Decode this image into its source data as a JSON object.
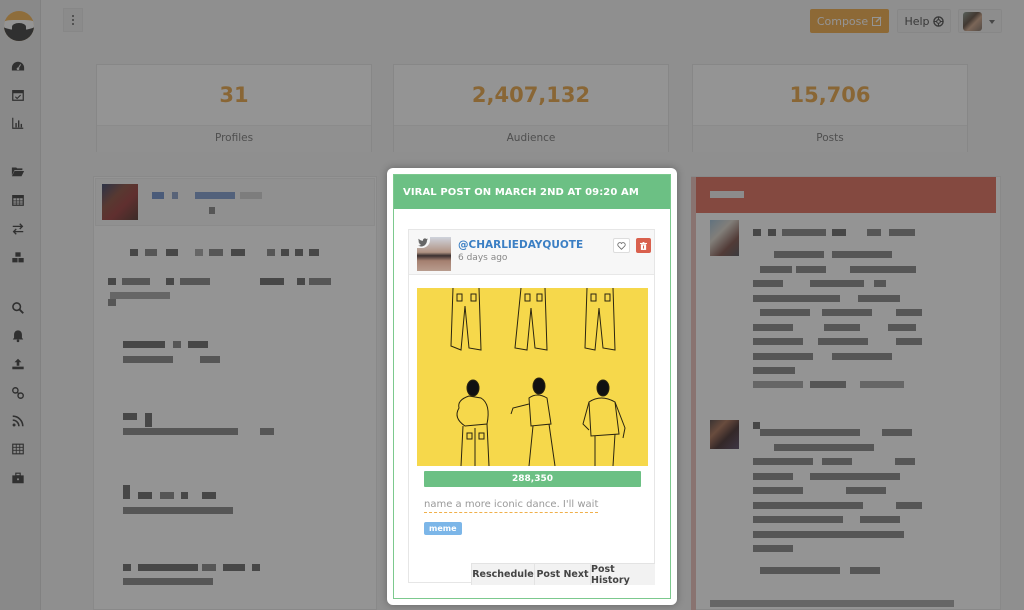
{
  "sidebar": {
    "logo": "app-logo",
    "items": [
      {
        "icon": "dashboard-icon"
      },
      {
        "icon": "calendar-check-icon"
      },
      {
        "icon": "bar-chart-icon"
      },
      {
        "icon": "folder-open-icon"
      },
      {
        "icon": "calendar-icon"
      },
      {
        "icon": "exchange-icon"
      },
      {
        "icon": "cubes-icon"
      },
      {
        "icon": "search-icon"
      },
      {
        "icon": "bell-icon"
      },
      {
        "icon": "upload-icon"
      },
      {
        "icon": "link-icon"
      },
      {
        "icon": "rss-icon"
      },
      {
        "icon": "table-icon"
      },
      {
        "icon": "briefcase-icon"
      }
    ]
  },
  "topbar": {
    "compose_label": "Compose",
    "help_label": "Help"
  },
  "stats": [
    {
      "value": "31",
      "label": "Profiles"
    },
    {
      "value": "2,407,132",
      "label": "Audience"
    },
    {
      "value": "15,706",
      "label": "Posts"
    }
  ],
  "modal": {
    "title": "VIRAL POST ON MARCH 2ND AT 09:20 AM",
    "post": {
      "network": "twitter",
      "handle": "@CHARLIEDAYQUOTE",
      "time": "6 days ago",
      "engagement_count": "288,350",
      "caption": "name a more iconic dance. I'll wait",
      "tag": "meme",
      "actions": [
        "Reschedule",
        "Post Next",
        "Post History"
      ]
    }
  },
  "colors": {
    "accent": "#f0a030",
    "success": "#6cc084",
    "danger": "#d9604d",
    "link": "#3b7fc4",
    "tag": "#7cb6e8"
  }
}
